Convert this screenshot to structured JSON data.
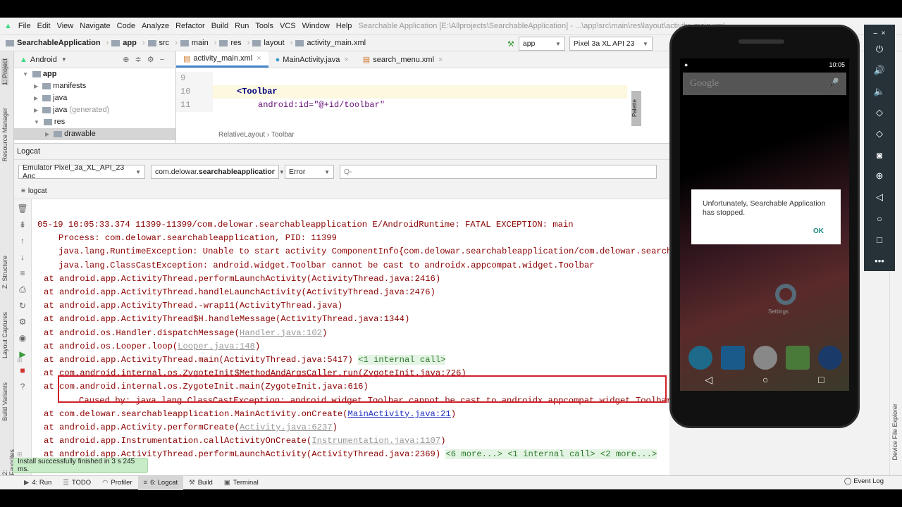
{
  "menu": {
    "items": [
      "File",
      "Edit",
      "View",
      "Navigate",
      "Code",
      "Analyze",
      "Refactor",
      "Build",
      "Run",
      "Tools",
      "VCS",
      "Window",
      "Help"
    ],
    "title": "Searchable Application [E:\\Allprojects\\SearchableApplication] - ...\\app\\src\\main\\res\\layout\\activity_main.xml"
  },
  "breadcrumb": [
    "SearchableApplication",
    "app",
    "src",
    "main",
    "res",
    "layout",
    "activity_main.xml"
  ],
  "run_config": {
    "module": "app",
    "device": "Pixel 3a XL API 23"
  },
  "project": {
    "view": "Android",
    "tree": [
      {
        "label": "app",
        "level": 0,
        "open": true
      },
      {
        "label": "manifests",
        "level": 1
      },
      {
        "label": "java",
        "level": 1
      },
      {
        "label": "java",
        "suffix": "(generated)",
        "level": 1
      },
      {
        "label": "res",
        "level": 1,
        "open": true
      },
      {
        "label": "drawable",
        "level": 2,
        "selected": true
      }
    ]
  },
  "editor": {
    "tabs": [
      {
        "label": "activity_main.xml",
        "active": true
      },
      {
        "label": "MainActivity.java"
      },
      {
        "label": "search_menu.xml"
      }
    ],
    "lines": [
      {
        "n": "9",
        "code": ""
      },
      {
        "n": "10",
        "code": "<Toolbar"
      },
      {
        "n": "11",
        "code": "android:id=\"@+id/toolbar\""
      }
    ],
    "path": [
      "RelativeLayout",
      "Toolbar"
    ],
    "palette": "Palette"
  },
  "logcat": {
    "title": "Logcat",
    "device": "Emulator Pixel_3a_XL_API_23 Anc",
    "package_prefix": "com.delowar.",
    "package_bold": "searchableapplicatior",
    "level": "Error",
    "search_placeholder": "Q-",
    "tab": "logcat",
    "lines": [
      {
        "i": 0,
        "p": [
          [
            "05-19 10:05:33.374 11399-11399/com.delowar.searchableapplication E/AndroidRuntime: FATAL EXCEPTION: main",
            ""
          ]
        ]
      },
      {
        "i": 1,
        "p": [
          [
            "Process: com.delowar.searchableapplication, PID: 11399",
            ""
          ]
        ]
      },
      {
        "i": 1,
        "p": [
          [
            "java.lang.RuntimeException: Unable to start activity ComponentInfo{com.delowar.searchableapplication/com.delowar.search",
            ""
          ]
        ]
      },
      {
        "i": 2,
        "p": [
          [
            "java.lang.ClassCastException: android.widget.Toolbar cannot be cast to androidx.appcompat.widget.Toolbar",
            ""
          ]
        ]
      },
      {
        "i": 3,
        "p": [
          [
            "at android.app.ActivityThread.performLaunchActivity(ActivityThread.java:2416)",
            ""
          ]
        ]
      },
      {
        "i": 3,
        "p": [
          [
            "at android.app.ActivityThread.handleLaunchActivity(ActivityThread.java:2476)",
            ""
          ]
        ]
      },
      {
        "i": 3,
        "p": [
          [
            "at android.app.ActivityThread.-wrap11(ActivityThread.java)",
            ""
          ]
        ]
      },
      {
        "i": 3,
        "p": [
          [
            "at android.app.ActivityThread$H.handleMessage(ActivityThread.java:1344)",
            ""
          ]
        ]
      },
      {
        "i": 3,
        "p": [
          [
            "at android.os.Handler.dispatchMessage(",
            ""
          ],
          [
            "Handler.java:102",
            "lnk"
          ],
          [
            ")",
            ""
          ]
        ]
      },
      {
        "i": 3,
        "p": [
          [
            "at android.os.Looper.loop(",
            ""
          ],
          [
            "Looper.java:148",
            "lnk"
          ],
          [
            ")",
            ""
          ]
        ]
      },
      {
        "i": 3,
        "fold": true,
        "p": [
          [
            "at android.app.ActivityThread.main(ActivityThread.java:5417) ",
            ""
          ],
          [
            "<1 internal call>",
            "fold-note"
          ]
        ]
      },
      {
        "i": 3,
        "p": [
          [
            "at com.android.internal.os.ZygoteInit$MethodAndArgsCaller.run(ZygoteInit.java:726)",
            ""
          ]
        ]
      },
      {
        "i": 3,
        "p": [
          [
            "at com.android.internal.os.ZygoteInit.main(ZygoteInit.java:616)",
            ""
          ]
        ]
      },
      {
        "i": 4,
        "p": [
          [
            "Caused by: java.lang.ClassCastException: android.widget.Toolbar cannot be cast to androidx.appcompat.widget.Toolbar",
            ""
          ]
        ]
      },
      {
        "i": 3,
        "p": [
          [
            "at com.delowar.searchableapplication.MainActivity.onCreate(",
            ""
          ],
          [
            "MainActivity.java:21",
            "blue"
          ],
          [
            ")",
            ""
          ]
        ]
      },
      {
        "i": 3,
        "p": [
          [
            "at android.app.Activity.performCreate(",
            ""
          ],
          [
            "Activity.java:6237",
            "lnk"
          ],
          [
            ")",
            ""
          ]
        ]
      },
      {
        "i": 3,
        "p": [
          [
            "at android.app.Instrumentation.callActivityOnCreate(",
            ""
          ],
          [
            "Instrumentation.java:1107",
            "lnk"
          ],
          [
            ")",
            ""
          ]
        ]
      },
      {
        "i": 3,
        "fold": true,
        "p": [
          [
            "at android.app.ActivityThread.performLaunchActivity(ActivityThread.java:2369) ",
            ""
          ],
          [
            "<6 more...> <1 internal call> <2 more...>",
            "fold-note"
          ]
        ]
      }
    ]
  },
  "toast": "Install successfully finished in 3 s 245 ms.",
  "bottom_tools": [
    {
      "label": "4: Run",
      "icon": "run-icon"
    },
    {
      "label": "TODO",
      "icon": "todo-icon"
    },
    {
      "label": "Profiler",
      "icon": "profiler-icon"
    },
    {
      "label": "6: Logcat",
      "icon": "logcat-icon",
      "active": true
    },
    {
      "label": "Build",
      "icon": "build-icon"
    },
    {
      "label": "Terminal",
      "icon": "terminal-icon"
    }
  ],
  "event_log": "Event Log",
  "side_labels": {
    "project": "1: Project",
    "resource_manager": "Resource Manager",
    "structure": "Z: Structure",
    "layout_captures": "Layout Captures",
    "build_variants": "Build Variants",
    "favorites": "2: Favorites",
    "device_file_explorer": "Device File Explorer"
  },
  "phone": {
    "time": "10:05",
    "search_hint": "Google",
    "dialog_text": "Unfortunately, Searchable Application has stopped.",
    "dialog_button": "OK",
    "app_label": "Settings"
  },
  "colors": {
    "error_text": "#8b0000",
    "highlight_box": "#d0202a",
    "toast_bg": "#c8ecc8",
    "emulator_bar": "#263238"
  }
}
